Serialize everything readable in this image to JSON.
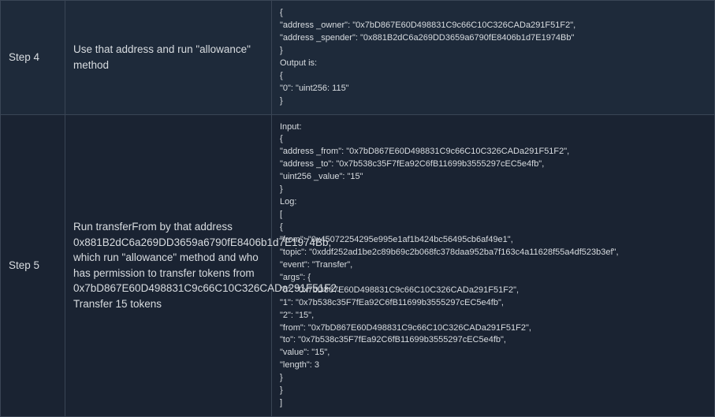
{
  "rows": [
    {
      "step": "Step 4",
      "description": "Use that address and run \"allowance\" method",
      "code": "{\n\"address _owner\": \"0x7bD867E60D498831C9c66C10C326CADa291F51F2\",\n\"address _spender\": \"0x881B2dC6a269DD3659a6790fE8406b1d7E1974Bb\"\n}\nOutput is:\n{\n\"0\": \"uint256: 115\"\n}"
    },
    {
      "step": "Step 5",
      "description": "Run transferFrom by that address 0x881B2dC6a269DD3659a6790fE8406b1d7E1974Bb, which run \"allowance\" method and who has permission to transfer tokens from 0x7bD867E60D498831C9c66C10C326CADa291F51F2. Transfer 15 tokens",
      "code": "Input:\n{\n\"address _from\": \"0x7bD867E60D498831C9c66C10C326CADa291F51F2\",\n\"address _to\": \"0x7b538c35F7fEa92C6fB11699b3555297cEC5e4fb\",\n\"uint256 _value\": \"15\"\n}\nLog:\n[\n{\n\"from\": \"0x45072254295e995e1af1b424bc56495cb6af49e1\",\n\"topic\": \"0xddf252ad1be2c89b69c2b068fc378daa952ba7f163c4a11628f55a4df523b3ef\",\n\"event\": \"Transfer\",\n\"args\": {\n\"0\": \"0x7bD867E60D498831C9c66C10C326CADa291F51F2\",\n\"1\": \"0x7b538c35F7fEa92C6fB11699b3555297cEC5e4fb\",\n\"2\": \"15\",\n\"from\": \"0x7bD867E60D498831C9c66C10C326CADa291F51F2\",\n\"to\": \"0x7b538c35F7fEa92C6fB11699b3555297cEC5e4fb\",\n\"value\": \"15\",\n\"length\": 3\n}\n}\n]"
    }
  ]
}
